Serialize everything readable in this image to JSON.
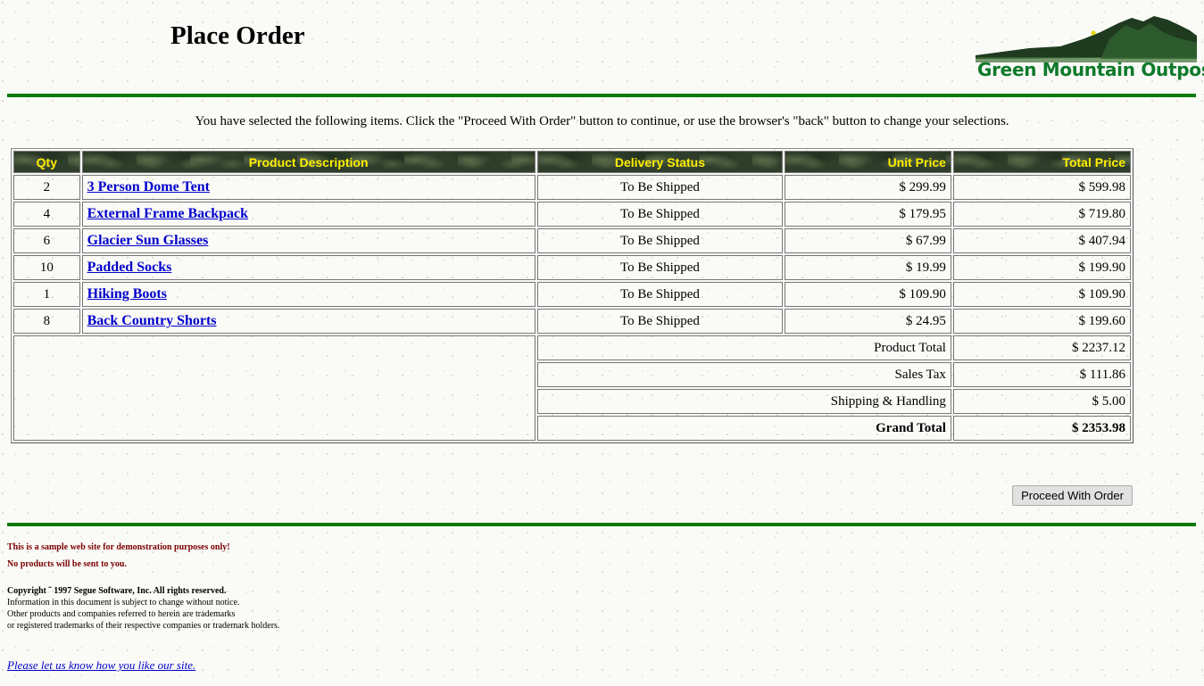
{
  "page": {
    "title": "Place Order"
  },
  "logo": {
    "text": "Green Mountain Outpost"
  },
  "intro": "You have selected the following items. Click the \"Proceed With Order\" button to continue, or use the browser's \"back\" button to change your selections.",
  "table": {
    "headers": [
      "Qty",
      "Product Description",
      "Delivery Status",
      "Unit Price",
      "Total Price"
    ],
    "rows": [
      {
        "qty": "2",
        "product": "3 Person Dome Tent",
        "status": "To Be Shipped",
        "unit": "$ 299.99",
        "total": "$ 599.98"
      },
      {
        "qty": "4",
        "product": "External Frame Backpack",
        "status": "To Be Shipped",
        "unit": "$ 179.95",
        "total": "$ 719.80"
      },
      {
        "qty": "6",
        "product": "Glacier Sun Glasses",
        "status": "To Be Shipped",
        "unit": "$ 67.99",
        "total": "$ 407.94"
      },
      {
        "qty": "10",
        "product": "Padded Socks",
        "status": "To Be Shipped",
        "unit": "$ 19.99",
        "total": "$ 199.90"
      },
      {
        "qty": "1",
        "product": "Hiking Boots",
        "status": "To Be Shipped",
        "unit": "$ 109.90",
        "total": "$ 109.90"
      },
      {
        "qty": "8",
        "product": "Back Country Shorts",
        "status": "To Be Shipped",
        "unit": "$ 24.95",
        "total": "$ 199.60"
      }
    ],
    "summary": [
      {
        "label": "Product Total",
        "value": "$ 2237.12"
      },
      {
        "label": "Sales Tax",
        "value": "$ 111.86"
      },
      {
        "label": "Shipping & Handling",
        "value": "$ 5.00"
      },
      {
        "label": "Grand Total",
        "value": "$ 2353.98"
      }
    ]
  },
  "proceed_button": "Proceed With Order",
  "footer": {
    "notice1": "This is a sample web site for demonstration purposes only!",
    "notice2": "No products will be sent to you.",
    "copyright": "Copyright ˜ 1997 Segue Software, Inc. All rights reserved.",
    "line1": "Information in this document is subject to change without notice.",
    "line2": "Other products and companies referred to herein are trademarks",
    "line3": "or registered trademarks of their respective companies or trademark holders.",
    "feedback_link": "Please let us know how you like our site."
  },
  "colors": {
    "rule": "#0a7a0a",
    "header_text": "#ffee00",
    "link": "#0000cc",
    "notice": "#7a0000"
  }
}
